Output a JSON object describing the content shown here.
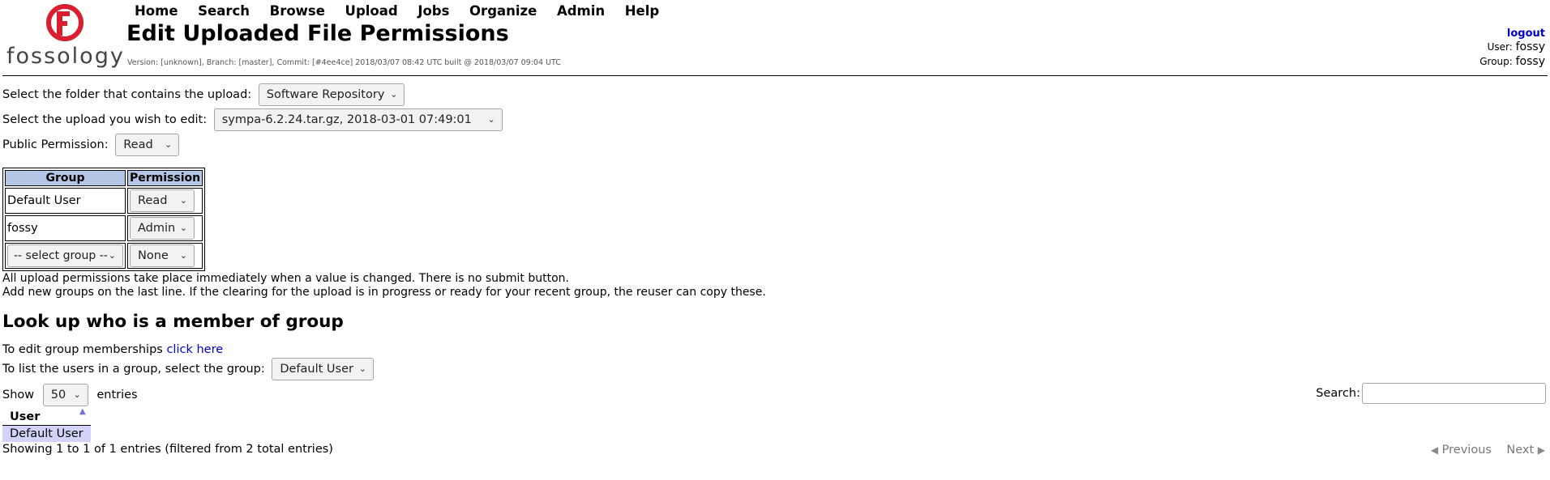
{
  "header": {
    "logo_text": "fossology",
    "menu": [
      "Home",
      "Search",
      "Browse",
      "Upload",
      "Jobs",
      "Organize",
      "Admin",
      "Help"
    ],
    "title": "Edit Uploaded File Permissions",
    "version": "Version: [unknown], Branch: [master], Commit: [#4ee4ce] 2018/03/07 08:42 UTC built @ 2018/03/07 09:04 UTC",
    "logout": "logout",
    "user_label": "User:",
    "user_value": "fossy",
    "group_label": "Group:",
    "group_value": "fossy"
  },
  "form": {
    "folder_label": "Select the folder that contains the upload:",
    "folder_value": "Software Repository",
    "upload_label": "Select the upload you wish to edit:",
    "upload_value": "sympa-6.2.24.tar.gz, 2018-03-01 07:49:01",
    "public_label": "Public Permission:",
    "public_value": "Read"
  },
  "perm_table": {
    "headers": [
      "Group",
      "Permission"
    ],
    "rows": [
      {
        "group": "Default User",
        "permission": "Read"
      },
      {
        "group": "fossy",
        "permission": "Admin"
      },
      {
        "group": "-- select group --",
        "permission": "None"
      }
    ]
  },
  "notes": [
    "All upload permissions take place immediately when a value is changed. There is no submit button.",
    "Add new groups on the last line. If the clearing for the upload is in progress or ready for your recent group, the reuser can copy these."
  ],
  "lookup": {
    "title": "Look up who is a member of group",
    "edit_text": "To edit group memberships",
    "edit_link": "click here",
    "list_label": "To list the users in a group, select the group:",
    "list_value": "Default User"
  },
  "datatable": {
    "show_label": "Show",
    "show_value": "50",
    "entries_label": "entries",
    "search_label": "Search:",
    "search_value": "",
    "column": "User",
    "rows": [
      "Default User"
    ],
    "info": "Showing 1 to 1 of 1 entries (filtered from 2 total entries)",
    "previous": "Previous",
    "next": "Next"
  },
  "colors": {
    "header_bg": "#b3c6e6",
    "row_highlight": "#d2d3fb",
    "link": "#0000cc",
    "logo_red": "#d91e2f"
  }
}
